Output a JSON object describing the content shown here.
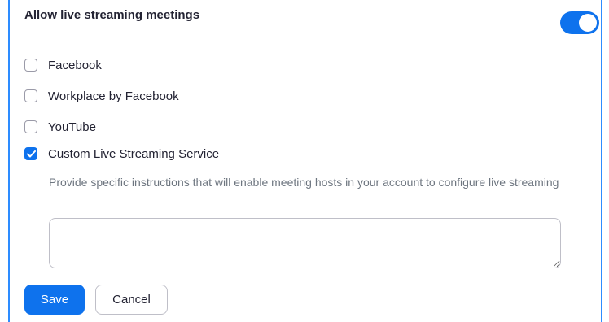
{
  "section": {
    "title": "Allow live streaming meetings",
    "toggle_on": true,
    "accent_color": "#0e72ed"
  },
  "options": [
    {
      "label": "Facebook",
      "checked": false
    },
    {
      "label": "Workplace by Facebook",
      "checked": false
    },
    {
      "label": "YouTube",
      "checked": false
    },
    {
      "label": "Custom Live Streaming Service",
      "checked": true
    }
  ],
  "custom_service": {
    "instructions": "Provide specific instructions that will enable meeting hosts in your account to configure live streaming",
    "textarea_value": "",
    "textarea_placeholder": ""
  },
  "actions": {
    "save_label": "Save",
    "cancel_label": "Cancel"
  },
  "icons": {
    "checkmark": "checkmark-icon",
    "resize_handle": "resize-handle-icon"
  }
}
